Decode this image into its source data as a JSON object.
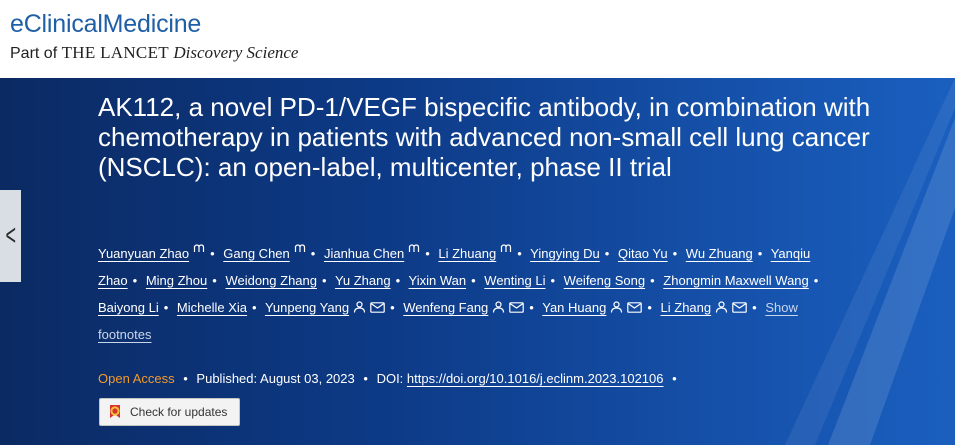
{
  "header": {
    "journal": "eClinicalMedicine",
    "part_of_prefix": "Part of",
    "lancet": "THE LANCET",
    "discovery": "Discovery Science"
  },
  "article": {
    "title": "AK112, a novel PD-1/VEGF bispecific antibody, in combination with chemotherapy in patients with advanced non-small cell lung cancer (NSCLC): an open-label, multicenter, phase II trial",
    "authors": [
      {
        "name": "Yuanyuan Zhao",
        "icons": [
          "m"
        ]
      },
      {
        "name": "Gang Chen",
        "icons": [
          "m"
        ]
      },
      {
        "name": "Jianhua Chen",
        "icons": [
          "m"
        ]
      },
      {
        "name": "Li Zhuang",
        "icons": [
          "m"
        ]
      },
      {
        "name": "Yingying Du",
        "icons": []
      },
      {
        "name": "Qitao Yu",
        "icons": []
      },
      {
        "name": "Wu Zhuang",
        "icons": []
      },
      {
        "name": "Yanqiu Zhao",
        "icons": []
      },
      {
        "name": "Ming Zhou",
        "icons": []
      },
      {
        "name": "Weidong Zhang",
        "icons": []
      },
      {
        "name": "Yu Zhang",
        "icons": []
      },
      {
        "name": "Yixin Wan",
        "icons": []
      },
      {
        "name": "Wenting Li",
        "icons": []
      },
      {
        "name": "Weifeng Song",
        "icons": []
      },
      {
        "name": "Zhongmin Maxwell Wang",
        "icons": []
      },
      {
        "name": "Baiyong Li",
        "icons": []
      },
      {
        "name": "Michelle Xia",
        "icons": []
      },
      {
        "name": "Yunpeng Yang",
        "icons": [
          "person",
          "mail"
        ]
      },
      {
        "name": "Wenfeng Fang",
        "icons": [
          "person",
          "mail"
        ]
      },
      {
        "name": "Yan Huang",
        "icons": [
          "person",
          "mail"
        ]
      },
      {
        "name": "Li Zhang",
        "icons": [
          "person",
          "mail"
        ]
      }
    ],
    "show_footnotes": "Show footnotes",
    "open_access": "Open Access",
    "published_label": "Published:",
    "published_date": "August 03, 2023",
    "doi_label": "DOI:",
    "doi": "https://doi.org/10.1016/j.eclinm.2023.102106",
    "check_updates": "Check for updates"
  },
  "colors": {
    "journal_blue": "#1f5fa5",
    "banner_dark": "#0b2a63",
    "banner_light": "#1a5fbf",
    "open_access_orange": "#f39a2d"
  }
}
